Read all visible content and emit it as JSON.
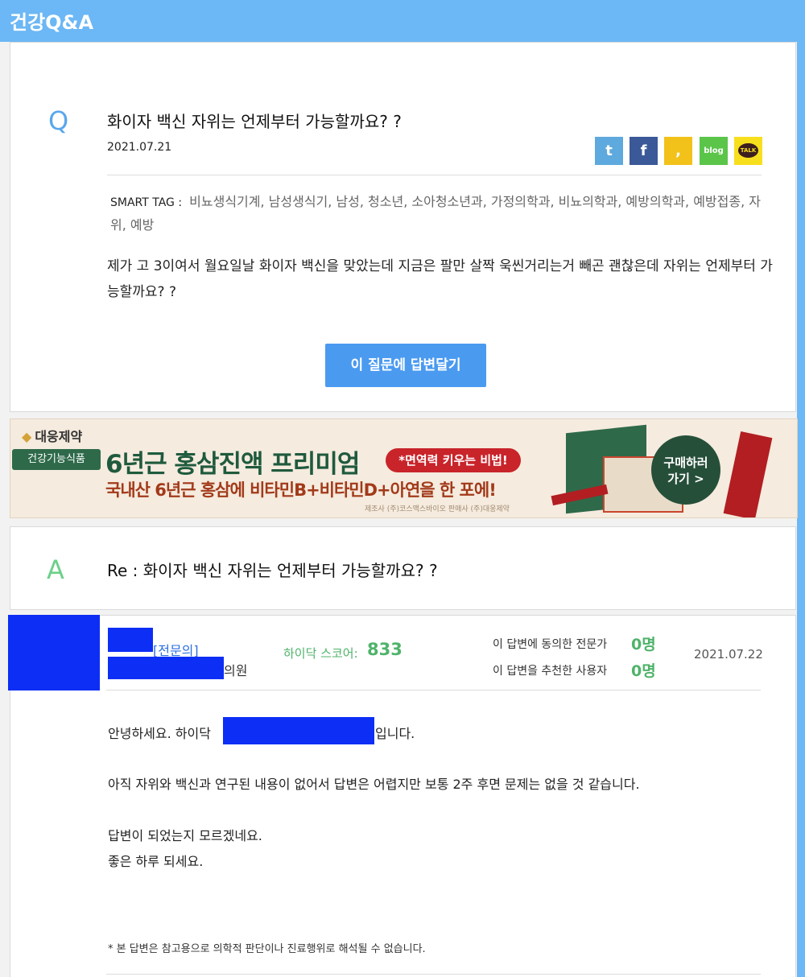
{
  "header": {
    "title": "건강Q&A"
  },
  "question": {
    "letter": "Q",
    "title": "화이자 백신 자위는 언제부터 가능할까요? ?",
    "date": "2021.07.21",
    "smart_tag_label": "SMART TAG :",
    "smart_tags": "비뇨생식기계, 남성생식기, 남성, 청소년, 소아청소년과, 가정의학과, 비뇨의학과, 예방의학과, 예방접종, 자위, 예방",
    "body": "제가 고 3이여서 월요일날 화이자 백신을 맞았는데 지금은 팔만 살짝 욱씬거리는거 빼곤 괜찮은데 자위는 언제부터 가능할까요? ?",
    "answer_button": "이 질문에 답변달기"
  },
  "share": {
    "twitter": "twitter-icon",
    "facebook": "facebook-icon",
    "story": "kakaostory-icon",
    "blog": "blog-icon",
    "talk": "kakaotalk-icon",
    "blog_text": "blog",
    "talk_text": "TALK",
    "twitter_glyph": "t",
    "facebook_glyph": "f",
    "story_glyph": ","
  },
  "ad": {
    "brand": "대웅제약",
    "category": "건강기능식품",
    "headline": "6년근 홍삼진액 프리미엄",
    "pill": "*면역력 키우는 비법!",
    "subline": "국내산 6년근 홍삼에 비타민B+비타민D+아연을 한 포에!",
    "maker": "제조사 (주)코스맥스바이오 판매사 (주)대웅제약",
    "buy_line1": "구매하러",
    "buy_line2": "가기 >"
  },
  "answer": {
    "letter": "A",
    "title": "Re : 화이자 백신 자위는 언제부터 가능할까요? ?",
    "specialist_tag": "[전문의]",
    "hospital_suffix": "의원",
    "score_label": "하이닥 스코어:",
    "score_value": "833",
    "agree_label": "이 답변에 동의한 전문가",
    "agree_value": "0명",
    "recommend_label": "이 답변을 추천한 사용자",
    "recommend_value": "0명",
    "date": "2021.07.22",
    "greeting_prefix": "안녕하세요. 하이닥",
    "greeting_suffix": "입니다.",
    "para1": "아직 자위와 백신과 연구된 내용이 없어서 답변은 어렵지만 보통 2주 후면 문제는 없을 것 같습니다.",
    "para2_line1": "답변이 되었는지 모르겠네요.",
    "para2_line2": "좋은 하루 되세요.",
    "disclaimer": "* 본 답변은 참고용으로 의학적 판단이나 진료행위로 해석될 수 없습니다."
  },
  "colors": {
    "header_bg": "#6cb7f5",
    "question_letter": "#5aa7ec",
    "answer_letter": "#6cd08a",
    "button_bg": "#4a9af0",
    "score_green": "#4fb36a",
    "redaction": "#0d2ef5"
  }
}
